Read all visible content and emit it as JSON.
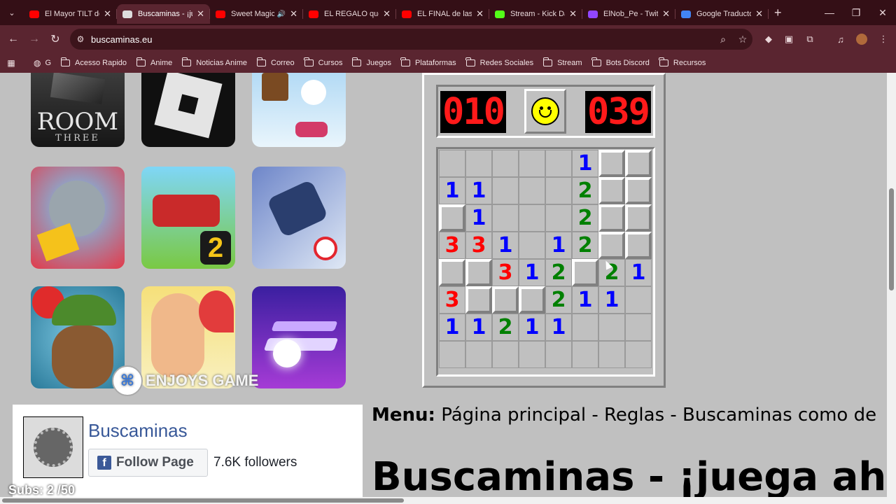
{
  "tabs": [
    {
      "title": "El Mayor TILT de",
      "icon": "youtube-icon",
      "active": false
    },
    {
      "title": "Buscaminas - ¡ju",
      "icon": "minesweeper-icon",
      "active": true
    },
    {
      "title": "Sweet Magic",
      "icon": "youtube-icon",
      "active": false,
      "audio": true
    },
    {
      "title": "EL REGALO que l",
      "icon": "youtube-icon",
      "active": false
    },
    {
      "title": "EL FINAL de las l",
      "icon": "youtube-icon",
      "active": false
    },
    {
      "title": "Stream - Kick Da",
      "icon": "kick-icon",
      "active": false
    },
    {
      "title": "ElNob_Pe - Twitc",
      "icon": "twitch-icon",
      "active": false
    },
    {
      "title": "Google Traducto",
      "icon": "google-translate-icon",
      "active": false
    }
  ],
  "url": "buscaminas.eu",
  "bookmarks": [
    "G",
    "Acesso Rapido",
    "Anime",
    "Noticias Anime",
    "Correo",
    "Cursos",
    "Juegos",
    "Plataformas",
    "Redes Sociales",
    "Stream",
    "Bots Discord",
    "Recursos"
  ],
  "game": {
    "mines_counter": "010",
    "time_counter": "039",
    "board": [
      [
        "",
        "",
        "",
        "",
        "",
        "1",
        "#",
        "#"
      ],
      [
        "1",
        "1",
        "",
        "",
        "",
        "2",
        "#",
        "#"
      ],
      [
        "#",
        "1",
        "",
        "",
        "",
        "2",
        "#",
        "#"
      ],
      [
        "3",
        "3",
        "1",
        "",
        "1",
        "2",
        "#",
        "#"
      ],
      [
        "#",
        "#",
        "3",
        "1",
        "2",
        "#",
        "2",
        "1"
      ],
      [
        "3",
        "#",
        "#",
        "#",
        "2",
        "1",
        "1",
        ""
      ],
      [
        "1",
        "1",
        "2",
        "1",
        "1",
        "",
        "",
        ""
      ],
      [
        "",
        "",
        "",
        "",
        "",
        "",
        "",
        ""
      ]
    ]
  },
  "apps": [
    {
      "name": "The Room Three",
      "text": "ROOM",
      "subtext": "THREE"
    },
    {
      "name": "Roblox"
    },
    {
      "name": "Human Fall Flat"
    },
    {
      "name": "Talking Tom Gold Run"
    },
    {
      "name": "Hill Climb Racing 2",
      "text": "2"
    },
    {
      "name": "Free Fire"
    },
    {
      "name": "Bloons TD"
    },
    {
      "name": "Toca Kitchen"
    },
    {
      "name": "Tiles Hop"
    }
  ],
  "watermark": "ENJOYS GAME",
  "facebook": {
    "page_name": "Buscaminas",
    "follow_label": "Follow Page",
    "followers": "7.6K followers"
  },
  "menu": {
    "label": "Menu:",
    "text": "Página principal - Reglas - Buscaminas como de"
  },
  "headline": "Buscaminas - ¡juega aho",
  "overlay": "Subs: 2 /50"
}
